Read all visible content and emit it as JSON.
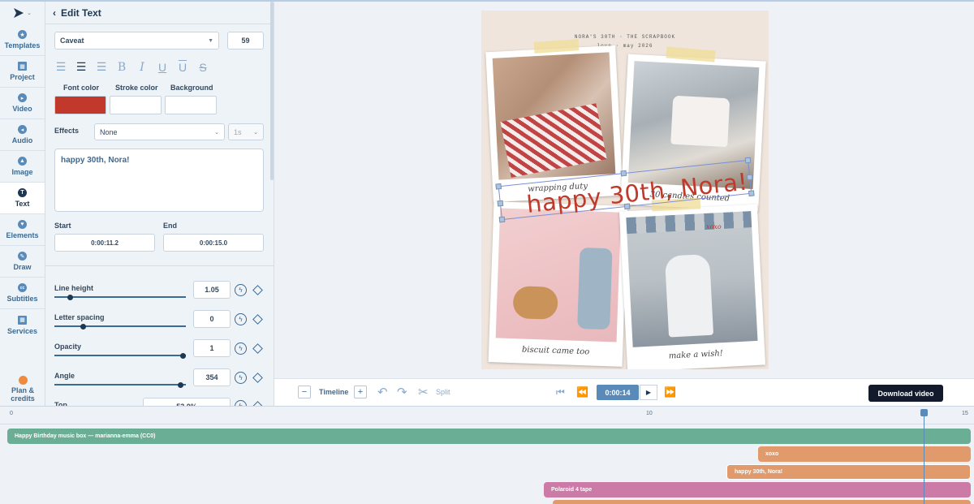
{
  "nav": {
    "items": [
      {
        "label": "Templates",
        "icon": "star-icon"
      },
      {
        "label": "Project",
        "icon": "grid-icon"
      },
      {
        "label": "Video",
        "icon": "play-icon"
      },
      {
        "label": "Audio",
        "icon": "audio-icon"
      },
      {
        "label": "Image",
        "icon": "image-icon"
      },
      {
        "label": "Text",
        "icon": "text-icon"
      },
      {
        "label": "Elements",
        "icon": "elements-icon"
      },
      {
        "label": "Draw",
        "icon": "pen-icon"
      },
      {
        "label": "Subtitles",
        "icon": "cc-icon"
      },
      {
        "label": "Services",
        "icon": "services-icon"
      }
    ],
    "plan_line1": "Plan &",
    "plan_line2": "credits"
  },
  "panel": {
    "title": "Edit Text",
    "font": "Caveat",
    "font_size": "59",
    "font_color_label": "Font color",
    "stroke_color_label": "Stroke color",
    "background_label": "Background",
    "font_color": "#c0392b",
    "effects_label": "Effects",
    "effects_value": "None",
    "effects_duration": "1s",
    "text_value": "happy 30th, Nora!",
    "start_label": "Start",
    "end_label": "End",
    "start_value": "0:00:11.2",
    "end_value": "0:00:15.0",
    "line_height_label": "Line height",
    "line_height_value": "1.05",
    "letter_spacing_label": "Letter spacing",
    "letter_spacing_value": "0",
    "opacity_label": "Opacity",
    "opacity_value": "1",
    "angle_label": "Angle",
    "angle_value": "354",
    "top_label": "Top",
    "top_value": "53.0%"
  },
  "preview": {
    "header_line1": "NORA'S 30TH · THE SCRAPBOOK",
    "header_line2": "love · may 2026",
    "caption_1": "wrapping duty",
    "caption_2": "30 candles counted",
    "caption_3": "biscuit came too",
    "caption_4": "make a wish!",
    "headline": "happy 30th, Nora!",
    "xoxo": "xoxo"
  },
  "toolbar": {
    "timeline_label": "Timeline",
    "split_label": "Split",
    "current_time": "0:00:14",
    "download_label": "Download video"
  },
  "timeline": {
    "ticks": [
      "0",
      "10",
      "15"
    ],
    "clips": [
      {
        "label": "Happy Birthday music box — marianna-emma (CC0)",
        "color": "#6aae96"
      },
      {
        "label": "xoxo",
        "color": "#e19a6c"
      },
      {
        "label": "happy 30th, Nora!",
        "color": "#e19a6c"
      },
      {
        "label": "Polaroid 4 tape",
        "color": "#cc7aa6"
      }
    ]
  }
}
